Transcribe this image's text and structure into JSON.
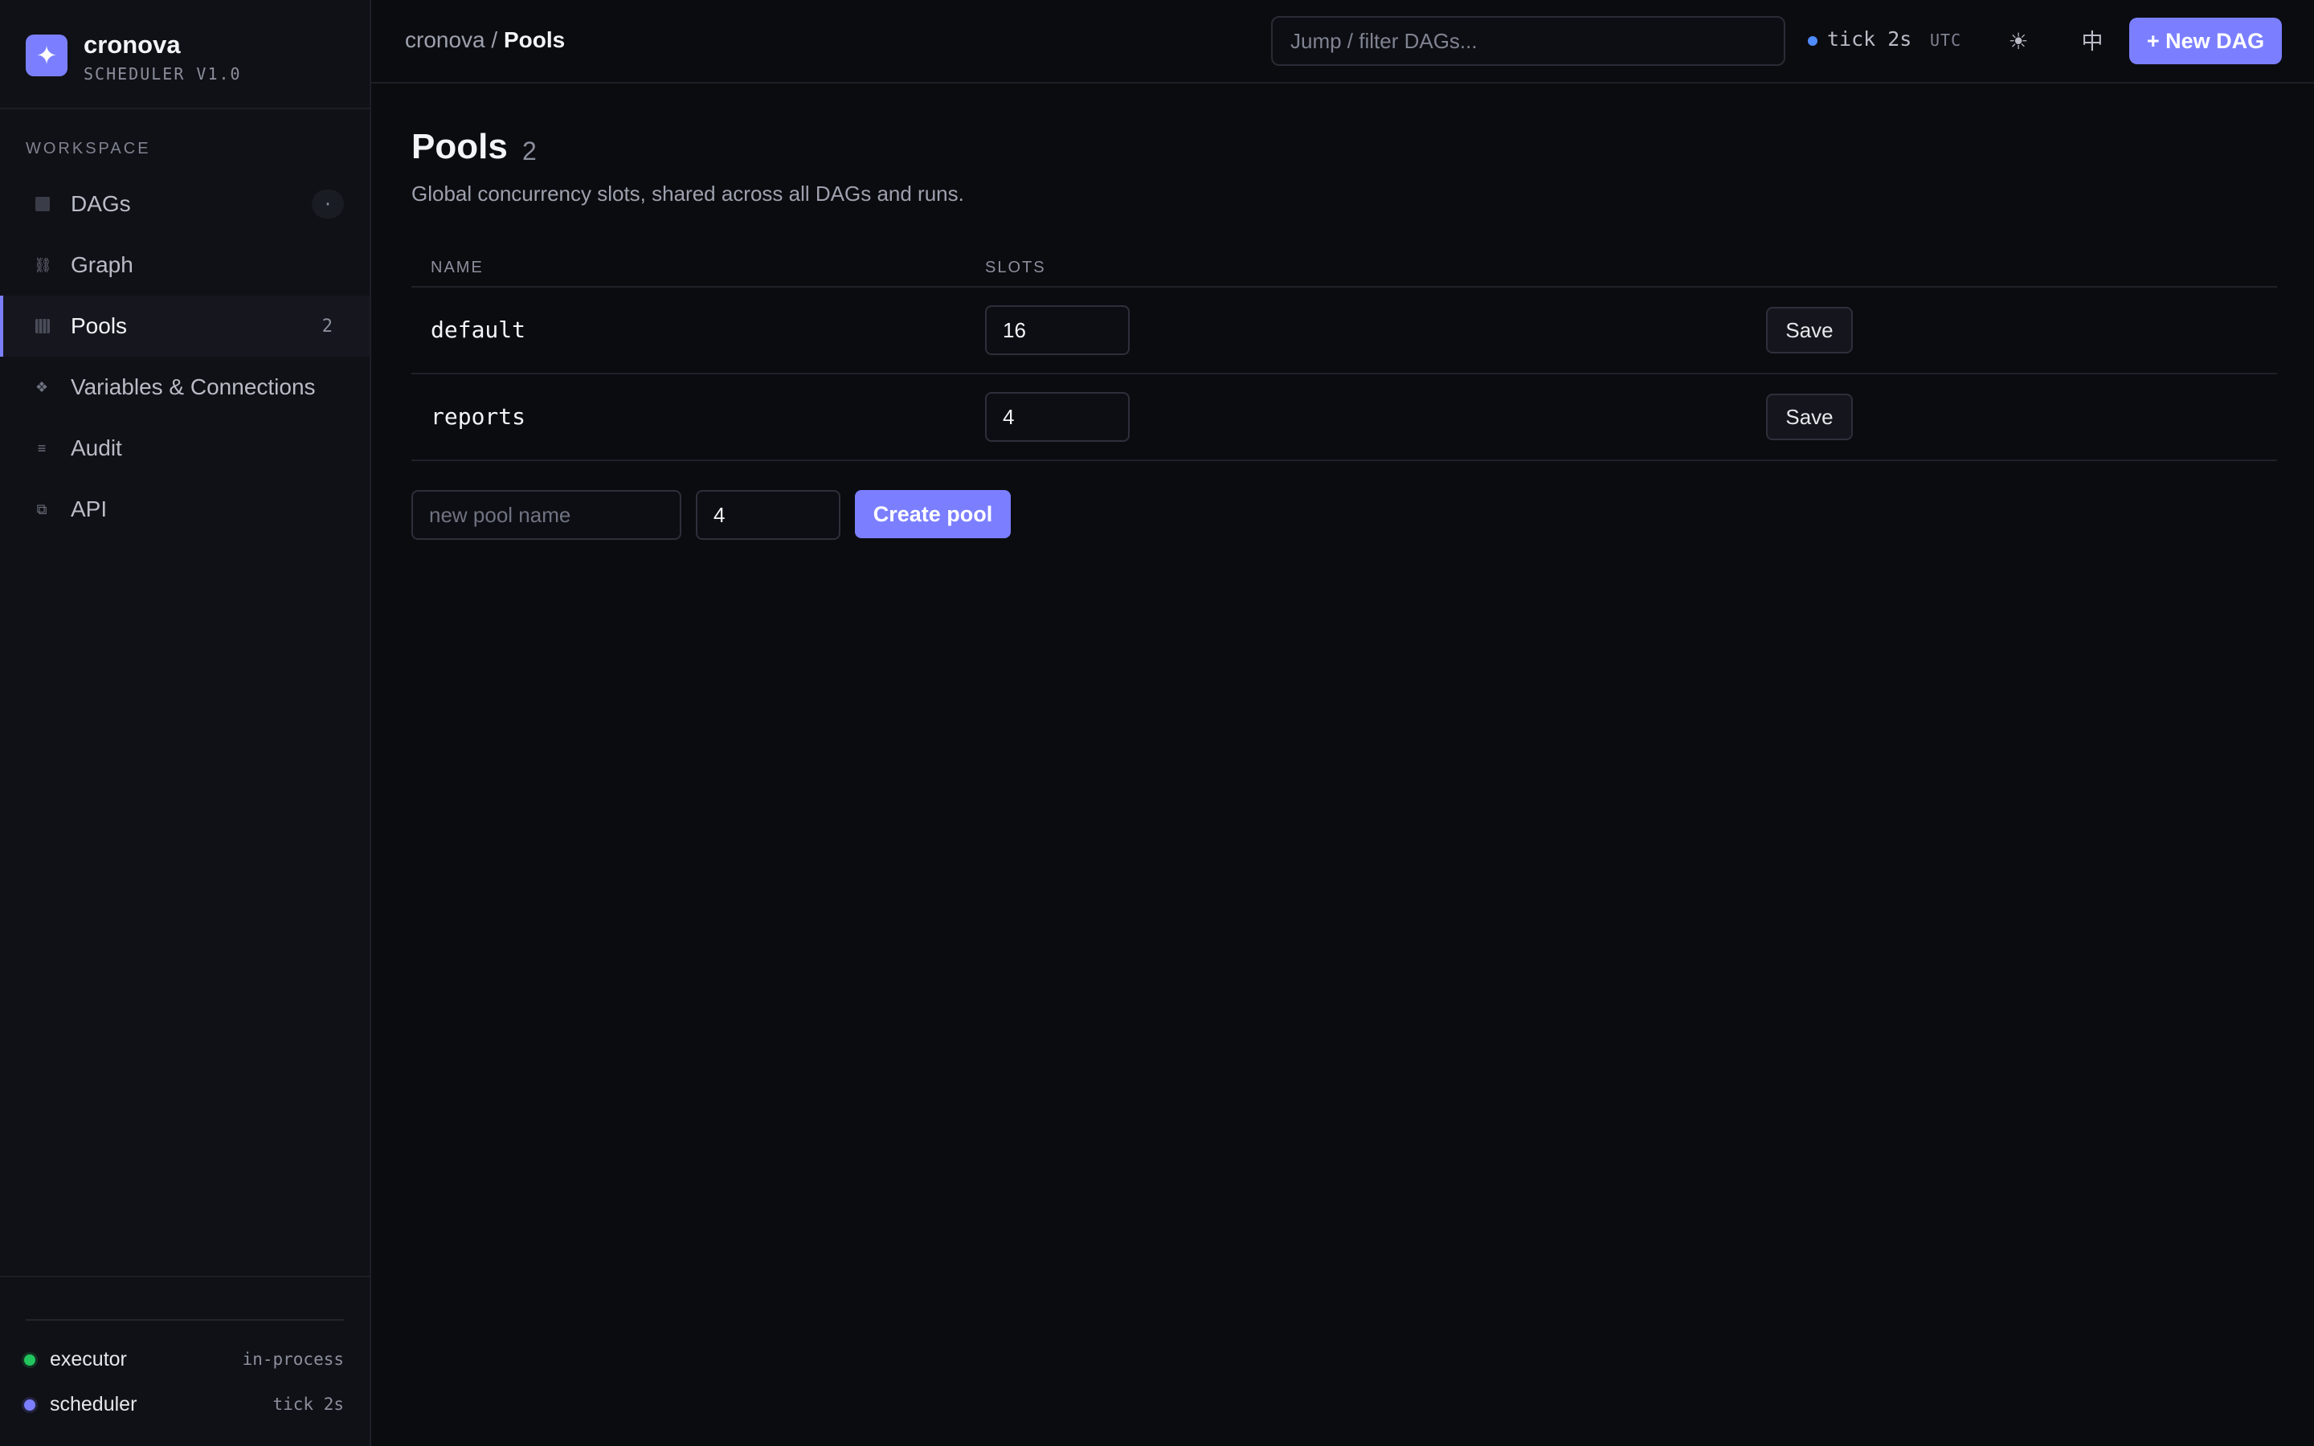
{
  "app": {
    "name": "cronova",
    "subtitle": "SCHEDULER V1.0",
    "logo_icon": "sparkle-icon",
    "accent": "#7b7fff"
  },
  "sidebar": {
    "section": "WORKSPACE",
    "items": [
      {
        "label": "DAGs",
        "icon": "square-icon",
        "badge": "·"
      },
      {
        "label": "Graph",
        "icon": "link-icon",
        "count": ""
      },
      {
        "label": "Pools",
        "icon": "grid-icon",
        "count": "2",
        "active": true
      },
      {
        "label": "Variables & Connections",
        "icon": "diamond-icon",
        "count": ""
      },
      {
        "label": "Audit",
        "icon": "list-icon",
        "count": ""
      },
      {
        "label": "API",
        "icon": "copy-icon",
        "count": ""
      }
    ],
    "status": [
      {
        "name": "executor",
        "value": "in-process",
        "color": "#22c55e"
      },
      {
        "name": "scheduler",
        "value": "tick 2s",
        "color": "#7b7fff"
      }
    ]
  },
  "topbar": {
    "breadcrumb_root": "cronova",
    "breadcrumb_sep": " / ",
    "breadcrumb_current": "Pools",
    "search_placeholder": "Jump / filter DAGs...",
    "tick": "tick 2s",
    "timezone": "UTC",
    "theme_icon": "☀",
    "lang_label": "中",
    "new_dag_label": "+ New DAG"
  },
  "main": {
    "title": "Pools",
    "count": "2",
    "description": "Global concurrency slots, shared across all DAGs and runs.",
    "columns": {
      "name": "NAME",
      "slots": "SLOTS"
    },
    "rows": [
      {
        "name": "default",
        "slots": "16",
        "save_label": "Save"
      },
      {
        "name": "reports",
        "slots": "4",
        "save_label": "Save"
      }
    ],
    "create": {
      "name_placeholder": "new pool name",
      "slots_value": "4",
      "button_label": "Create pool"
    }
  }
}
